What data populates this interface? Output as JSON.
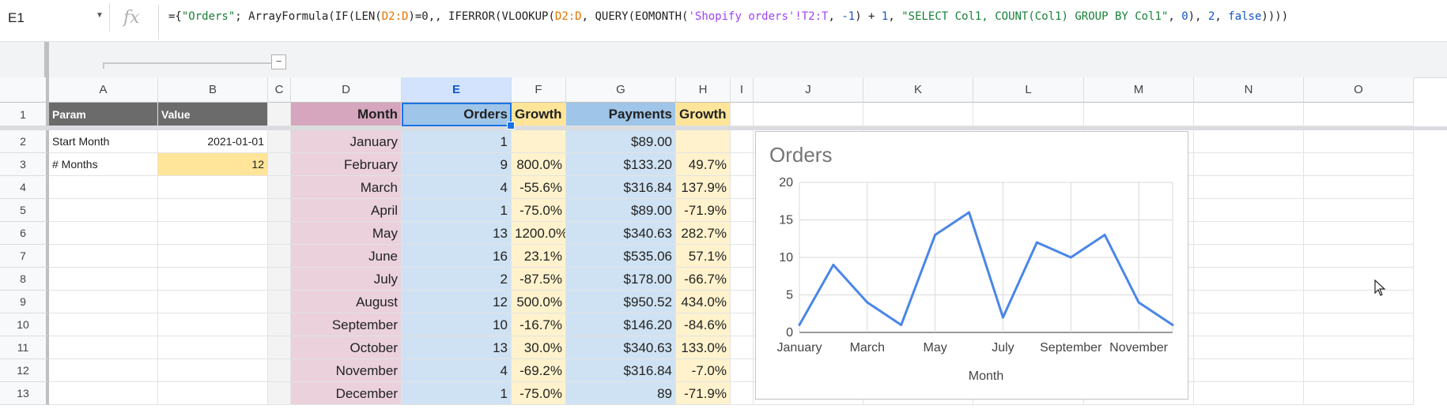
{
  "namebox": "E1",
  "formula_bar": {
    "parts": [
      {
        "t": "={",
        "k": "plain"
      },
      {
        "t": "\"Orders\"",
        "k": "str"
      },
      {
        "t": "; ArrayFormula(IF(LEN(",
        "k": "plain"
      },
      {
        "t": "D2:D",
        "k": "ref"
      },
      {
        "t": ")=0,, IFERROR(VLOOKUP(",
        "k": "plain"
      },
      {
        "t": "D2:D",
        "k": "ref"
      },
      {
        "t": ", QUERY(EOMONTH(",
        "k": "plain"
      },
      {
        "t": "'Shopify orders'!T2:T",
        "k": "sheet"
      },
      {
        "t": ", ",
        "k": "plain"
      },
      {
        "t": "-1",
        "k": "num"
      },
      {
        "t": ") + ",
        "k": "plain"
      },
      {
        "t": "1",
        "k": "num"
      },
      {
        "t": ", ",
        "k": "plain"
      },
      {
        "t": "\"SELECT Col1, COUNT(Col1) GROUP BY Col1\"",
        "k": "str"
      },
      {
        "t": ", ",
        "k": "plain"
      },
      {
        "t": "0",
        "k": "num"
      },
      {
        "t": "), ",
        "k": "plain"
      },
      {
        "t": "2",
        "k": "num"
      },
      {
        "t": ", ",
        "k": "plain"
      },
      {
        "t": "false",
        "k": "num"
      },
      {
        "t": "))))",
        "k": "plain"
      }
    ]
  },
  "fx_label": "fx",
  "group_button": "−",
  "columns": [
    "A",
    "B",
    "C",
    "D",
    "E",
    "F",
    "G",
    "H",
    "I",
    "J",
    "K",
    "L",
    "M",
    "N",
    "O"
  ],
  "selected_column": "E",
  "rows": [
    "1",
    "2",
    "3",
    "4",
    "5",
    "6",
    "7",
    "8",
    "9",
    "10",
    "11",
    "12",
    "13"
  ],
  "params": {
    "header": {
      "param": "Param",
      "value": "Value"
    },
    "rows": [
      {
        "label": "Start Month",
        "value": "2021-01-01"
      },
      {
        "label": "# Months",
        "value": "12"
      }
    ]
  },
  "table": {
    "headers": {
      "month": "Month",
      "orders": "Orders",
      "growth1": "Growth",
      "payments": "Payments",
      "growth2": "Growth"
    },
    "rows": [
      {
        "month": "January",
        "orders": "1",
        "growth1": "",
        "payments": "$89.00",
        "growth2": ""
      },
      {
        "month": "February",
        "orders": "9",
        "growth1": "800.0%",
        "payments": "$133.20",
        "growth2": "49.7%"
      },
      {
        "month": "March",
        "orders": "4",
        "growth1": "-55.6%",
        "payments": "$316.84",
        "growth2": "137.9%"
      },
      {
        "month": "April",
        "orders": "1",
        "growth1": "-75.0%",
        "payments": "$89.00",
        "growth2": "-71.9%"
      },
      {
        "month": "May",
        "orders": "13",
        "growth1": "1200.0%",
        "payments": "$340.63",
        "growth2": "282.7%"
      },
      {
        "month": "June",
        "orders": "16",
        "growth1": "23.1%",
        "payments": "$535.06",
        "growth2": "57.1%"
      },
      {
        "month": "July",
        "orders": "2",
        "growth1": "-87.5%",
        "payments": "$178.00",
        "growth2": "-66.7%"
      },
      {
        "month": "August",
        "orders": "12",
        "growth1": "500.0%",
        "payments": "$950.52",
        "growth2": "434.0%"
      },
      {
        "month": "September",
        "orders": "10",
        "growth1": "-16.7%",
        "payments": "$146.20",
        "growth2": "-84.6%"
      },
      {
        "month": "October",
        "orders": "13",
        "growth1": "30.0%",
        "payments": "$340.63",
        "growth2": "133.0%"
      },
      {
        "month": "November",
        "orders": "4",
        "growth1": "-69.2%",
        "payments": "$316.84",
        "growth2": "-7.0%"
      },
      {
        "month": "December",
        "orders": "1",
        "growth1": "-75.0%",
        "payments": "89",
        "growth2": "-71.9%"
      }
    ]
  },
  "chart_data": {
    "type": "line",
    "title": "Orders",
    "xlabel": "Month",
    "ylabel": "",
    "categories": [
      "January",
      "February",
      "March",
      "April",
      "May",
      "June",
      "July",
      "August",
      "September",
      "October",
      "November",
      "December"
    ],
    "x_tick_labels": [
      "January",
      "March",
      "May",
      "July",
      "September",
      "November"
    ],
    "series": [
      {
        "values": [
          1,
          9,
          4,
          1,
          13,
          16,
          2,
          12,
          10,
          13,
          4,
          1
        ],
        "color": "#4a86e8"
      }
    ],
    "ylim": [
      0,
      20
    ],
    "y_ticks": [
      "0",
      "5",
      "10",
      "15",
      "20"
    ],
    "grid": true,
    "legend": "none"
  }
}
